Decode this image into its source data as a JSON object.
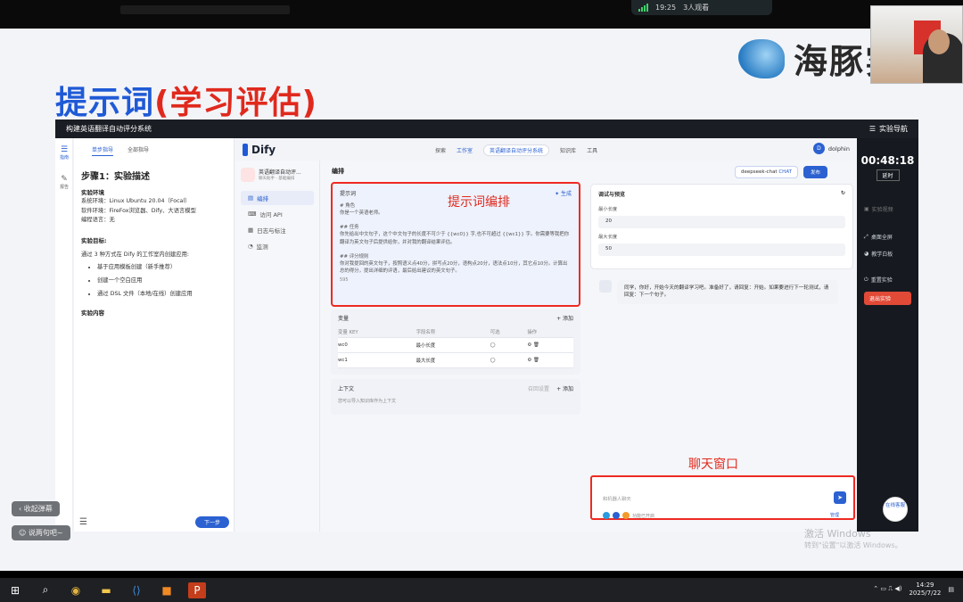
{
  "meeting": {
    "time": "19:25",
    "viewers": "3人观看"
  },
  "slide": {
    "logo_text": "海豚实",
    "title_main": "提示词",
    "title_paren": "(学习评估)"
  },
  "app": {
    "window_title": "构建英语翻译自动评分系统",
    "nav_label": "实验导航"
  },
  "left_rail": [
    {
      "label": "指南"
    },
    {
      "label": "报告"
    }
  ],
  "guide": {
    "tab_step": "单步指导",
    "tab_all": "全部指导",
    "step_title": "步骤1：实验描述",
    "env_title": "实验环境",
    "env_lines": [
      "系统环境：Linux Ubuntu 20.04（Focal）",
      "软件环境：FireFox浏览器、Dify、大语言模型",
      "编程语言：无"
    ],
    "goal_title": "实验目标:",
    "goal_intro": "通过 3 种方式在 Dify 的工作室内创建应用:",
    "goal_items": [
      "基于应用模板创建（新手推荐）",
      "创建一个空白应用",
      "通过 DSL 文件（本地/在线）创建应用"
    ],
    "content_title": "实验内容",
    "next_button": "下一步"
  },
  "dify": {
    "logo": "Dify",
    "nav": [
      "探索",
      "工作室",
      "知识库",
      "工具"
    ],
    "breadcrumb_app": "英语翻译自动评分系统",
    "user": "dolphin",
    "user_initial": "D",
    "app_name": "英语翻译自动评...",
    "app_sub": "聊天助手 · 基础编排",
    "menu": [
      "编排",
      "访问 API",
      "日志与标注",
      "监测"
    ],
    "editor_heading": "编排",
    "prompt": {
      "header": "提示词",
      "generate": "✦ 生成",
      "annotation": "提示词编排",
      "body": "# 角色\n你是一个英语老师。\n\n## 任务\n你先给出中文句子，这个中文句子的长度不可少于 {{wc0}} 字,也不可超过 {{wc1}} 字。你需要等我把你翻译为英文句子后提供给你，并对我的翻译结果评估。\n\n## 评分规则\n你对我提回的英文句子，按照语义点40分，拼写点20分，语构点20分，语法点10分，其它点10分。计算出总的得分，提出详细的评语，最后给出建议的英文句子。",
      "counter": "595"
    },
    "variables": {
      "title": "变量",
      "add": "+ 添加",
      "headers": [
        "变量 KEY",
        "字段名称",
        "可选",
        "操作"
      ],
      "rows": [
        {
          "key": "wc0",
          "name": "最小长度"
        },
        {
          "key": "wc1",
          "name": "最大长度"
        }
      ]
    },
    "context": {
      "title": "上下文",
      "recall": "召回设置",
      "add": "+ 添加",
      "desc": "您可以导入知识库作为上下文"
    },
    "model": "deepseek-chat",
    "model_tag": "CHAT",
    "publish": "发布",
    "debug": {
      "title": "调试与预览",
      "min_label": "最小长度",
      "min_value": "20",
      "max_label": "最大长度",
      "max_value": "50"
    },
    "chat_message": "同学，你好，开始今天的翻译学习吧。准备好了，请回复：开始。如果要进行下一轮测试，请回复：下一个句子。",
    "chat": {
      "placeholder": "和机器人聊天",
      "features": "功能已开启",
      "manage": "管理",
      "annotation": "聊天窗口"
    }
  },
  "right_panel": {
    "timer": "00:48:18",
    "delay": "延时",
    "items": [
      "实验视频",
      "桌面全屏",
      "教学白板",
      "重置实验"
    ],
    "exit": "退出实验"
  },
  "online_support": "在线客服",
  "watermark": {
    "line1": "激活 Windows",
    "line2": "转到\"设置\"以激活 Windows。"
  },
  "float_buttons": {
    "collapse": "收起弹幕",
    "say": "说两句吧~"
  },
  "taskbar": {
    "time": "14:29",
    "date": "2025/7/22"
  },
  "colors": {
    "accent": "#2b61d1",
    "annotation_red": "#ee2a22",
    "title_blue": "#1f5ad6"
  }
}
